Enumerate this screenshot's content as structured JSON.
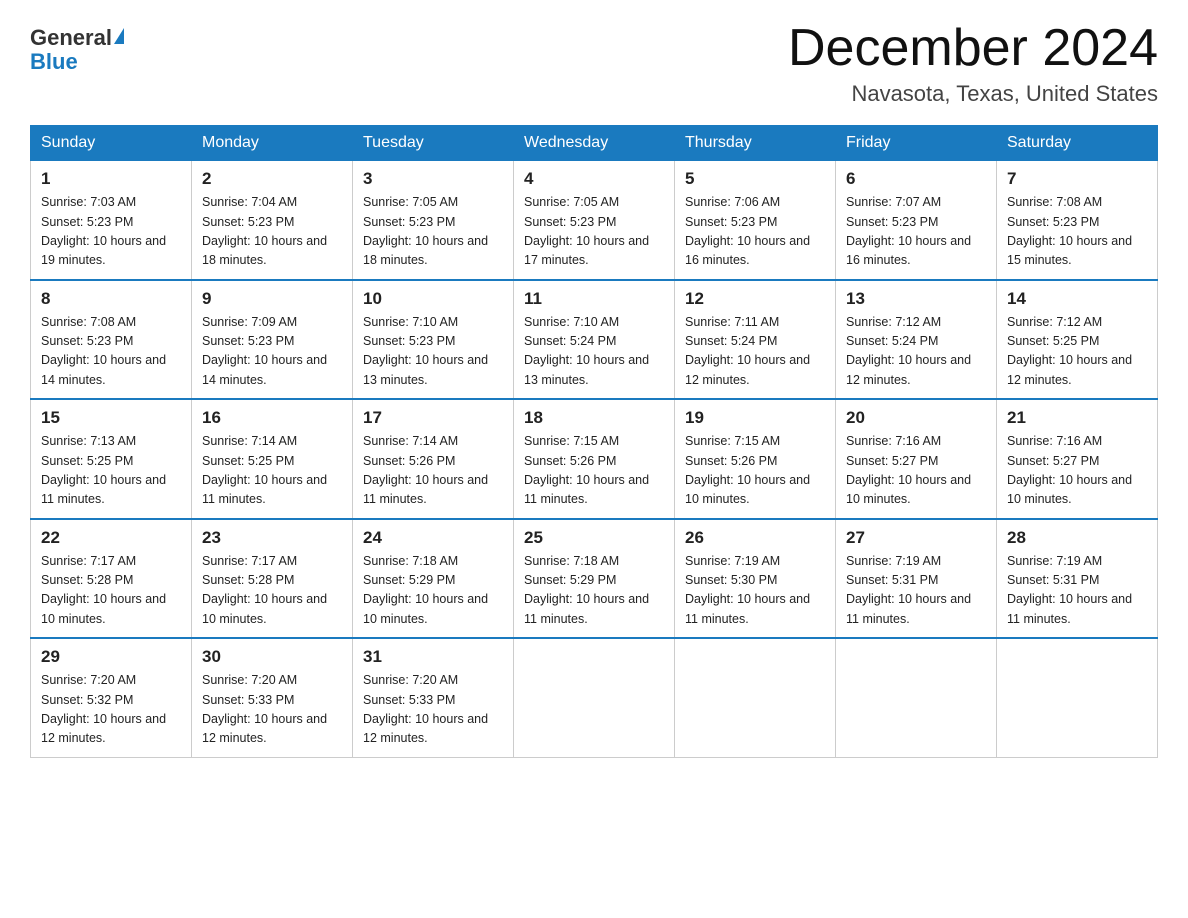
{
  "logo": {
    "text_general": "General",
    "text_blue": "Blue"
  },
  "header": {
    "month": "December 2024",
    "location": "Navasota, Texas, United States"
  },
  "days_of_week": [
    "Sunday",
    "Monday",
    "Tuesday",
    "Wednesday",
    "Thursday",
    "Friday",
    "Saturday"
  ],
  "weeks": [
    [
      {
        "day": "1",
        "sunrise": "7:03 AM",
        "sunset": "5:23 PM",
        "daylight": "10 hours and 19 minutes."
      },
      {
        "day": "2",
        "sunrise": "7:04 AM",
        "sunset": "5:23 PM",
        "daylight": "10 hours and 18 minutes."
      },
      {
        "day": "3",
        "sunrise": "7:05 AM",
        "sunset": "5:23 PM",
        "daylight": "10 hours and 18 minutes."
      },
      {
        "day": "4",
        "sunrise": "7:05 AM",
        "sunset": "5:23 PM",
        "daylight": "10 hours and 17 minutes."
      },
      {
        "day": "5",
        "sunrise": "7:06 AM",
        "sunset": "5:23 PM",
        "daylight": "10 hours and 16 minutes."
      },
      {
        "day": "6",
        "sunrise": "7:07 AM",
        "sunset": "5:23 PM",
        "daylight": "10 hours and 16 minutes."
      },
      {
        "day": "7",
        "sunrise": "7:08 AM",
        "sunset": "5:23 PM",
        "daylight": "10 hours and 15 minutes."
      }
    ],
    [
      {
        "day": "8",
        "sunrise": "7:08 AM",
        "sunset": "5:23 PM",
        "daylight": "10 hours and 14 minutes."
      },
      {
        "day": "9",
        "sunrise": "7:09 AM",
        "sunset": "5:23 PM",
        "daylight": "10 hours and 14 minutes."
      },
      {
        "day": "10",
        "sunrise": "7:10 AM",
        "sunset": "5:23 PM",
        "daylight": "10 hours and 13 minutes."
      },
      {
        "day": "11",
        "sunrise": "7:10 AM",
        "sunset": "5:24 PM",
        "daylight": "10 hours and 13 minutes."
      },
      {
        "day": "12",
        "sunrise": "7:11 AM",
        "sunset": "5:24 PM",
        "daylight": "10 hours and 12 minutes."
      },
      {
        "day": "13",
        "sunrise": "7:12 AM",
        "sunset": "5:24 PM",
        "daylight": "10 hours and 12 minutes."
      },
      {
        "day": "14",
        "sunrise": "7:12 AM",
        "sunset": "5:25 PM",
        "daylight": "10 hours and 12 minutes."
      }
    ],
    [
      {
        "day": "15",
        "sunrise": "7:13 AM",
        "sunset": "5:25 PM",
        "daylight": "10 hours and 11 minutes."
      },
      {
        "day": "16",
        "sunrise": "7:14 AM",
        "sunset": "5:25 PM",
        "daylight": "10 hours and 11 minutes."
      },
      {
        "day": "17",
        "sunrise": "7:14 AM",
        "sunset": "5:26 PM",
        "daylight": "10 hours and 11 minutes."
      },
      {
        "day": "18",
        "sunrise": "7:15 AM",
        "sunset": "5:26 PM",
        "daylight": "10 hours and 11 minutes."
      },
      {
        "day": "19",
        "sunrise": "7:15 AM",
        "sunset": "5:26 PM",
        "daylight": "10 hours and 10 minutes."
      },
      {
        "day": "20",
        "sunrise": "7:16 AM",
        "sunset": "5:27 PM",
        "daylight": "10 hours and 10 minutes."
      },
      {
        "day": "21",
        "sunrise": "7:16 AM",
        "sunset": "5:27 PM",
        "daylight": "10 hours and 10 minutes."
      }
    ],
    [
      {
        "day": "22",
        "sunrise": "7:17 AM",
        "sunset": "5:28 PM",
        "daylight": "10 hours and 10 minutes."
      },
      {
        "day": "23",
        "sunrise": "7:17 AM",
        "sunset": "5:28 PM",
        "daylight": "10 hours and 10 minutes."
      },
      {
        "day": "24",
        "sunrise": "7:18 AM",
        "sunset": "5:29 PM",
        "daylight": "10 hours and 10 minutes."
      },
      {
        "day": "25",
        "sunrise": "7:18 AM",
        "sunset": "5:29 PM",
        "daylight": "10 hours and 11 minutes."
      },
      {
        "day": "26",
        "sunrise": "7:19 AM",
        "sunset": "5:30 PM",
        "daylight": "10 hours and 11 minutes."
      },
      {
        "day": "27",
        "sunrise": "7:19 AM",
        "sunset": "5:31 PM",
        "daylight": "10 hours and 11 minutes."
      },
      {
        "day": "28",
        "sunrise": "7:19 AM",
        "sunset": "5:31 PM",
        "daylight": "10 hours and 11 minutes."
      }
    ],
    [
      {
        "day": "29",
        "sunrise": "7:20 AM",
        "sunset": "5:32 PM",
        "daylight": "10 hours and 12 minutes."
      },
      {
        "day": "30",
        "sunrise": "7:20 AM",
        "sunset": "5:33 PM",
        "daylight": "10 hours and 12 minutes."
      },
      {
        "day": "31",
        "sunrise": "7:20 AM",
        "sunset": "5:33 PM",
        "daylight": "10 hours and 12 minutes."
      },
      null,
      null,
      null,
      null
    ]
  ]
}
